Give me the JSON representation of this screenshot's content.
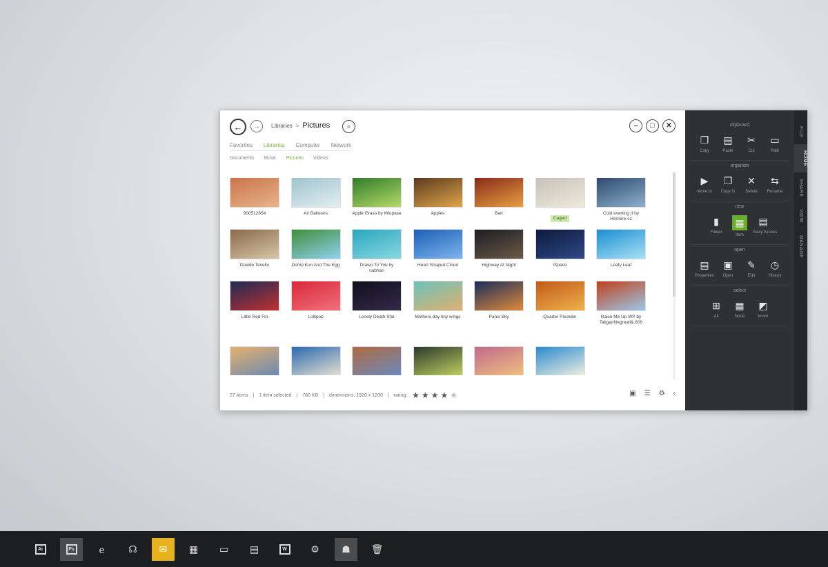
{
  "window": {
    "breadcrumb": {
      "root": "Libraries",
      "separator": ">",
      "current": "Pictures"
    },
    "location_tabs": [
      {
        "label": "Favorites",
        "active": false
      },
      {
        "label": "Libraries",
        "active": true
      },
      {
        "label": "Computer",
        "active": false
      },
      {
        "label": "Network",
        "active": false
      }
    ],
    "sub_tabs": [
      {
        "label": "Documents",
        "active": false
      },
      {
        "label": "Music",
        "active": false
      },
      {
        "label": "Pictures",
        "active": true
      },
      {
        "label": "Videos",
        "active": false
      }
    ],
    "items": [
      {
        "caption": "900512654",
        "colors": [
          "#c9744a",
          "#e8b48a"
        ]
      },
      {
        "caption": "Air Balloons",
        "colors": [
          "#9fc3cf",
          "#e3eef0"
        ]
      },
      {
        "caption": "Apple Grass by Mfupase",
        "colors": [
          "#2f7d2a",
          "#b7d86a"
        ]
      },
      {
        "caption": "Apples",
        "colors": [
          "#5a3a1e",
          "#e0a54a"
        ]
      },
      {
        "caption": "Bart",
        "colors": [
          "#8a2a1a",
          "#e6a040"
        ]
      },
      {
        "caption": "Caged",
        "colors": [
          "#c6c2b8",
          "#efe9dc"
        ],
        "selected": true
      },
      {
        "caption": "Cold evening II by Hombre-cz",
        "colors": [
          "#2c4a6e",
          "#8fb0cc"
        ]
      },
      {
        "caption": "Davide Tesello",
        "colors": [
          "#8a6a4a",
          "#d7c6a8"
        ]
      },
      {
        "caption": "Domo Kun And The Egg",
        "colors": [
          "#3f8f3a",
          "#8fd0f0"
        ]
      },
      {
        "caption": "Drawn To You by nabhan",
        "colors": [
          "#2aa7bf",
          "#8ad7e0"
        ]
      },
      {
        "caption": "Heart Shaped Cloud",
        "colors": [
          "#1c5fb8",
          "#7fb4ec"
        ]
      },
      {
        "caption": "Highway At Night",
        "colors": [
          "#1d1d22",
          "#6b5a48"
        ]
      },
      {
        "caption": "iSpace",
        "colors": [
          "#0d1a3a",
          "#2e4a8a"
        ]
      },
      {
        "caption": "Leafy Leaf",
        "colors": [
          "#1b8fd0",
          "#a8e0f7"
        ]
      },
      {
        "caption": "Little Red Fin",
        "colors": [
          "#1f2a55",
          "#c03030"
        ]
      },
      {
        "caption": "Lollipop",
        "colors": [
          "#d9283a",
          "#f0707a"
        ]
      },
      {
        "caption": "Lonely Death Star",
        "colors": [
          "#120f1e",
          "#332a4a"
        ]
      },
      {
        "caption": "Mothers day tiny wings",
        "colors": [
          "#6cc2b8",
          "#e0b070"
        ]
      },
      {
        "caption": "Panic Sky",
        "colors": [
          "#1a2d5a",
          "#e08a3a"
        ]
      },
      {
        "caption": "Quarter Pounder",
        "colors": [
          "#c05a1a",
          "#f0b24a"
        ]
      },
      {
        "caption": "Raise Me Up WP by TaliganNegreatl&.806",
        "colors": [
          "#c0401a",
          "#9bc8e8"
        ]
      },
      {
        "caption": "",
        "colors": [
          "#e6b070",
          "#6a8ab0"
        ]
      },
      {
        "caption": "",
        "colors": [
          "#2a6ab0",
          "#e8e0d0"
        ]
      },
      {
        "caption": "",
        "colors": [
          "#b06a40",
          "#6a8ac0"
        ]
      },
      {
        "caption": "",
        "colors": [
          "#2a3a2a",
          "#c0d060"
        ]
      },
      {
        "caption": "",
        "colors": [
          "#c06a8a",
          "#f0c080"
        ]
      },
      {
        "caption": "",
        "colors": [
          "#2a8ad0",
          "#f0f0e0"
        ]
      }
    ],
    "status": {
      "count": "27 items",
      "selected": "1 item selected",
      "size": "780 KB",
      "dimensions": "dimensions: 1920 x 1200",
      "rating_label": "rating:",
      "rating": 4,
      "rating_max": 5,
      "divider": "|"
    }
  },
  "ribbon": {
    "tabs": [
      {
        "label": "FILE",
        "active": false
      },
      {
        "label": "HOME",
        "active": true
      },
      {
        "label": "SHARE",
        "active": false
      },
      {
        "label": "VIEW",
        "active": false
      },
      {
        "label": "MANAGE",
        "active": false
      }
    ],
    "groups": [
      {
        "title": "clipboard",
        "buttons": [
          {
            "label": "Copy",
            "icon": "copy-icon",
            "glyph": "❐"
          },
          {
            "label": "Paste",
            "icon": "paste-icon",
            "glyph": "▤"
          },
          {
            "label": "Cut",
            "icon": "cut-icon",
            "glyph": "✂"
          },
          {
            "label": "Path",
            "icon": "path-icon",
            "glyph": "▭"
          }
        ]
      },
      {
        "title": "organize",
        "buttons": [
          {
            "label": "Move to",
            "icon": "move-to-icon",
            "glyph": "▶"
          },
          {
            "label": "Copy to",
            "icon": "copy-to-icon",
            "glyph": "❐"
          },
          {
            "label": "Delete",
            "icon": "delete-icon",
            "glyph": "✕"
          },
          {
            "label": "Rename",
            "icon": "rename-icon",
            "glyph": "⇆"
          }
        ]
      },
      {
        "title": "new",
        "buttons": [
          {
            "label": "Folder",
            "icon": "folder-icon",
            "glyph": "▮"
          },
          {
            "label": "Item",
            "icon": "new-item-icon",
            "glyph": "▦",
            "highlighted": true
          },
          {
            "label": "Easy Access",
            "icon": "easy-access-icon",
            "glyph": "▤"
          }
        ]
      },
      {
        "title": "open",
        "buttons": [
          {
            "label": "Properties",
            "icon": "properties-icon",
            "glyph": "▤"
          },
          {
            "label": "Open",
            "icon": "open-icon",
            "glyph": "▣"
          },
          {
            "label": "Edit",
            "icon": "edit-icon",
            "glyph": "✎"
          },
          {
            "label": "History",
            "icon": "history-icon",
            "glyph": "◷"
          }
        ]
      },
      {
        "title": "select",
        "buttons": [
          {
            "label": "All",
            "icon": "select-all-icon",
            "glyph": "⊞"
          },
          {
            "label": "None",
            "icon": "select-none-icon",
            "glyph": "▦"
          },
          {
            "label": "Invert",
            "icon": "invert-selection-icon",
            "glyph": "◩"
          }
        ]
      }
    ]
  },
  "taskbar": {
    "items": [
      {
        "name": "illustrator-icon",
        "glyph": "Ai",
        "boxed": true
      },
      {
        "name": "photoshop-icon",
        "glyph": "Ps",
        "boxed": true,
        "state": "gray"
      },
      {
        "name": "internet-explorer-icon",
        "glyph": "e"
      },
      {
        "name": "headphones-icon",
        "glyph": "☊"
      },
      {
        "name": "mail-icon",
        "glyph": "✉",
        "state": "yellow"
      },
      {
        "name": "calculator-icon",
        "glyph": "▦"
      },
      {
        "name": "notes-icon",
        "glyph": "▭"
      },
      {
        "name": "presentation-icon",
        "glyph": "▤"
      },
      {
        "name": "word-icon",
        "glyph": "W",
        "boxed": true
      },
      {
        "name": "settings-icon",
        "glyph": "⚙"
      },
      {
        "name": "people-icon",
        "glyph": "☗",
        "state": "gray"
      },
      {
        "name": "trash-icon",
        "glyph": "🗑"
      }
    ]
  }
}
